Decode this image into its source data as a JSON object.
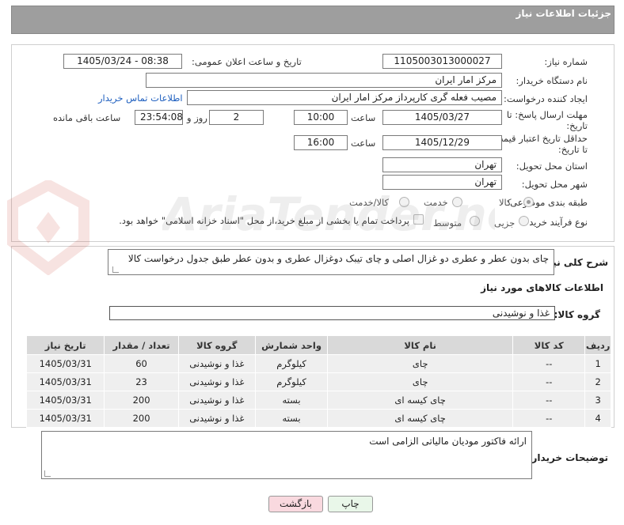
{
  "header": {
    "title": "جزئیات اطلاعات نیاز"
  },
  "form": {
    "need_number_label": "شماره نیاز:",
    "need_number": "1105003013000027",
    "announce_datetime_label": "تاریخ و ساعت اعلان عمومی:",
    "announce_datetime": "1405/03/24 - 08:38",
    "buyer_org_label": "نام دستگاه خریدار:",
    "buyer_org": "مرکز امار ایران",
    "creator_label": "ایجاد کننده درخواست:",
    "creator": "مصیب فعله گری کارپرداز مرکز امار ایران",
    "contact_link": "اطلاعات تماس خریدار",
    "reply_deadline_label_1": "مهلت ارسال پاسخ: تا",
    "reply_deadline_label_2": "تاریخ:",
    "reply_date": "1405/03/27",
    "hour_label": "ساعت",
    "reply_time": "10:00",
    "days_value": "2",
    "days_label": "روز و",
    "remaining_time": "23:54:08",
    "remaining_label": "ساعت باقی مانده",
    "validity_label_1": "حداقل تاریخ اعتبار قیمت:",
    "validity_label_2": "تا تاریخ:",
    "validity_date": "1405/12/29",
    "validity_time": "16:00",
    "province_label": "استان محل تحویل:",
    "province": "تهران",
    "city_label": "شهر محل تحویل:",
    "city": "تهران",
    "category_label": "طبقه بندی موضوعی:",
    "category_options": [
      "کالا",
      "خدمت",
      "کالا/خدمت"
    ],
    "process_label": "نوع فرآیند خرید :",
    "process_options": [
      "جزیی",
      "متوسط"
    ],
    "payment_note": "پرداخت تمام یا بخشی از مبلغ خرید،از محل \"اسناد خزانه اسلامی\" خواهد بود."
  },
  "description": {
    "label": "شرح کلی نیاز:",
    "text": "چای بدون عطر و عطری دو غزال اصلی و چای تیبک دوغزال عطری و بدون عطر طبق جدول درخواست کالا"
  },
  "goods": {
    "section_title": "اطلاعات کالاهای مورد نیاز",
    "group_label": "گروه کالا:",
    "group_value": "غذا و نوشیدنی",
    "columns": [
      "ردیف",
      "کد کالا",
      "نام کالا",
      "واحد شمارش",
      "گروه کالا",
      "تعداد / مقدار",
      "تاریخ نیاز"
    ],
    "rows": [
      [
        "1",
        "--",
        "چای",
        "کیلوگرم",
        "غذا و نوشیدنی",
        "60",
        "1405/03/31"
      ],
      [
        "2",
        "--",
        "چای",
        "کیلوگرم",
        "غذا و نوشیدنی",
        "23",
        "1405/03/31"
      ],
      [
        "3",
        "--",
        "چای کیسه ای",
        "بسته",
        "غذا و نوشیدنی",
        "200",
        "1405/03/31"
      ],
      [
        "4",
        "--",
        "چای کیسه ای",
        "بسته",
        "غذا و نوشیدنی",
        "200",
        "1405/03/31"
      ]
    ]
  },
  "buyer_notes": {
    "label": "توضیحات خریدار:",
    "text": "ارائه فاکتور مودیان مالیاتی الزامی است"
  },
  "buttons": {
    "print": "چاپ",
    "back": "بازگشت"
  },
  "watermark": {
    "text": "AriaTender.neT"
  },
  "colors": {
    "header_bg": "#9e9e9e",
    "link": "#1e5fbf",
    "back_button_bg": "#f9d9df",
    "print_button_bg": "#e9f7e9"
  }
}
